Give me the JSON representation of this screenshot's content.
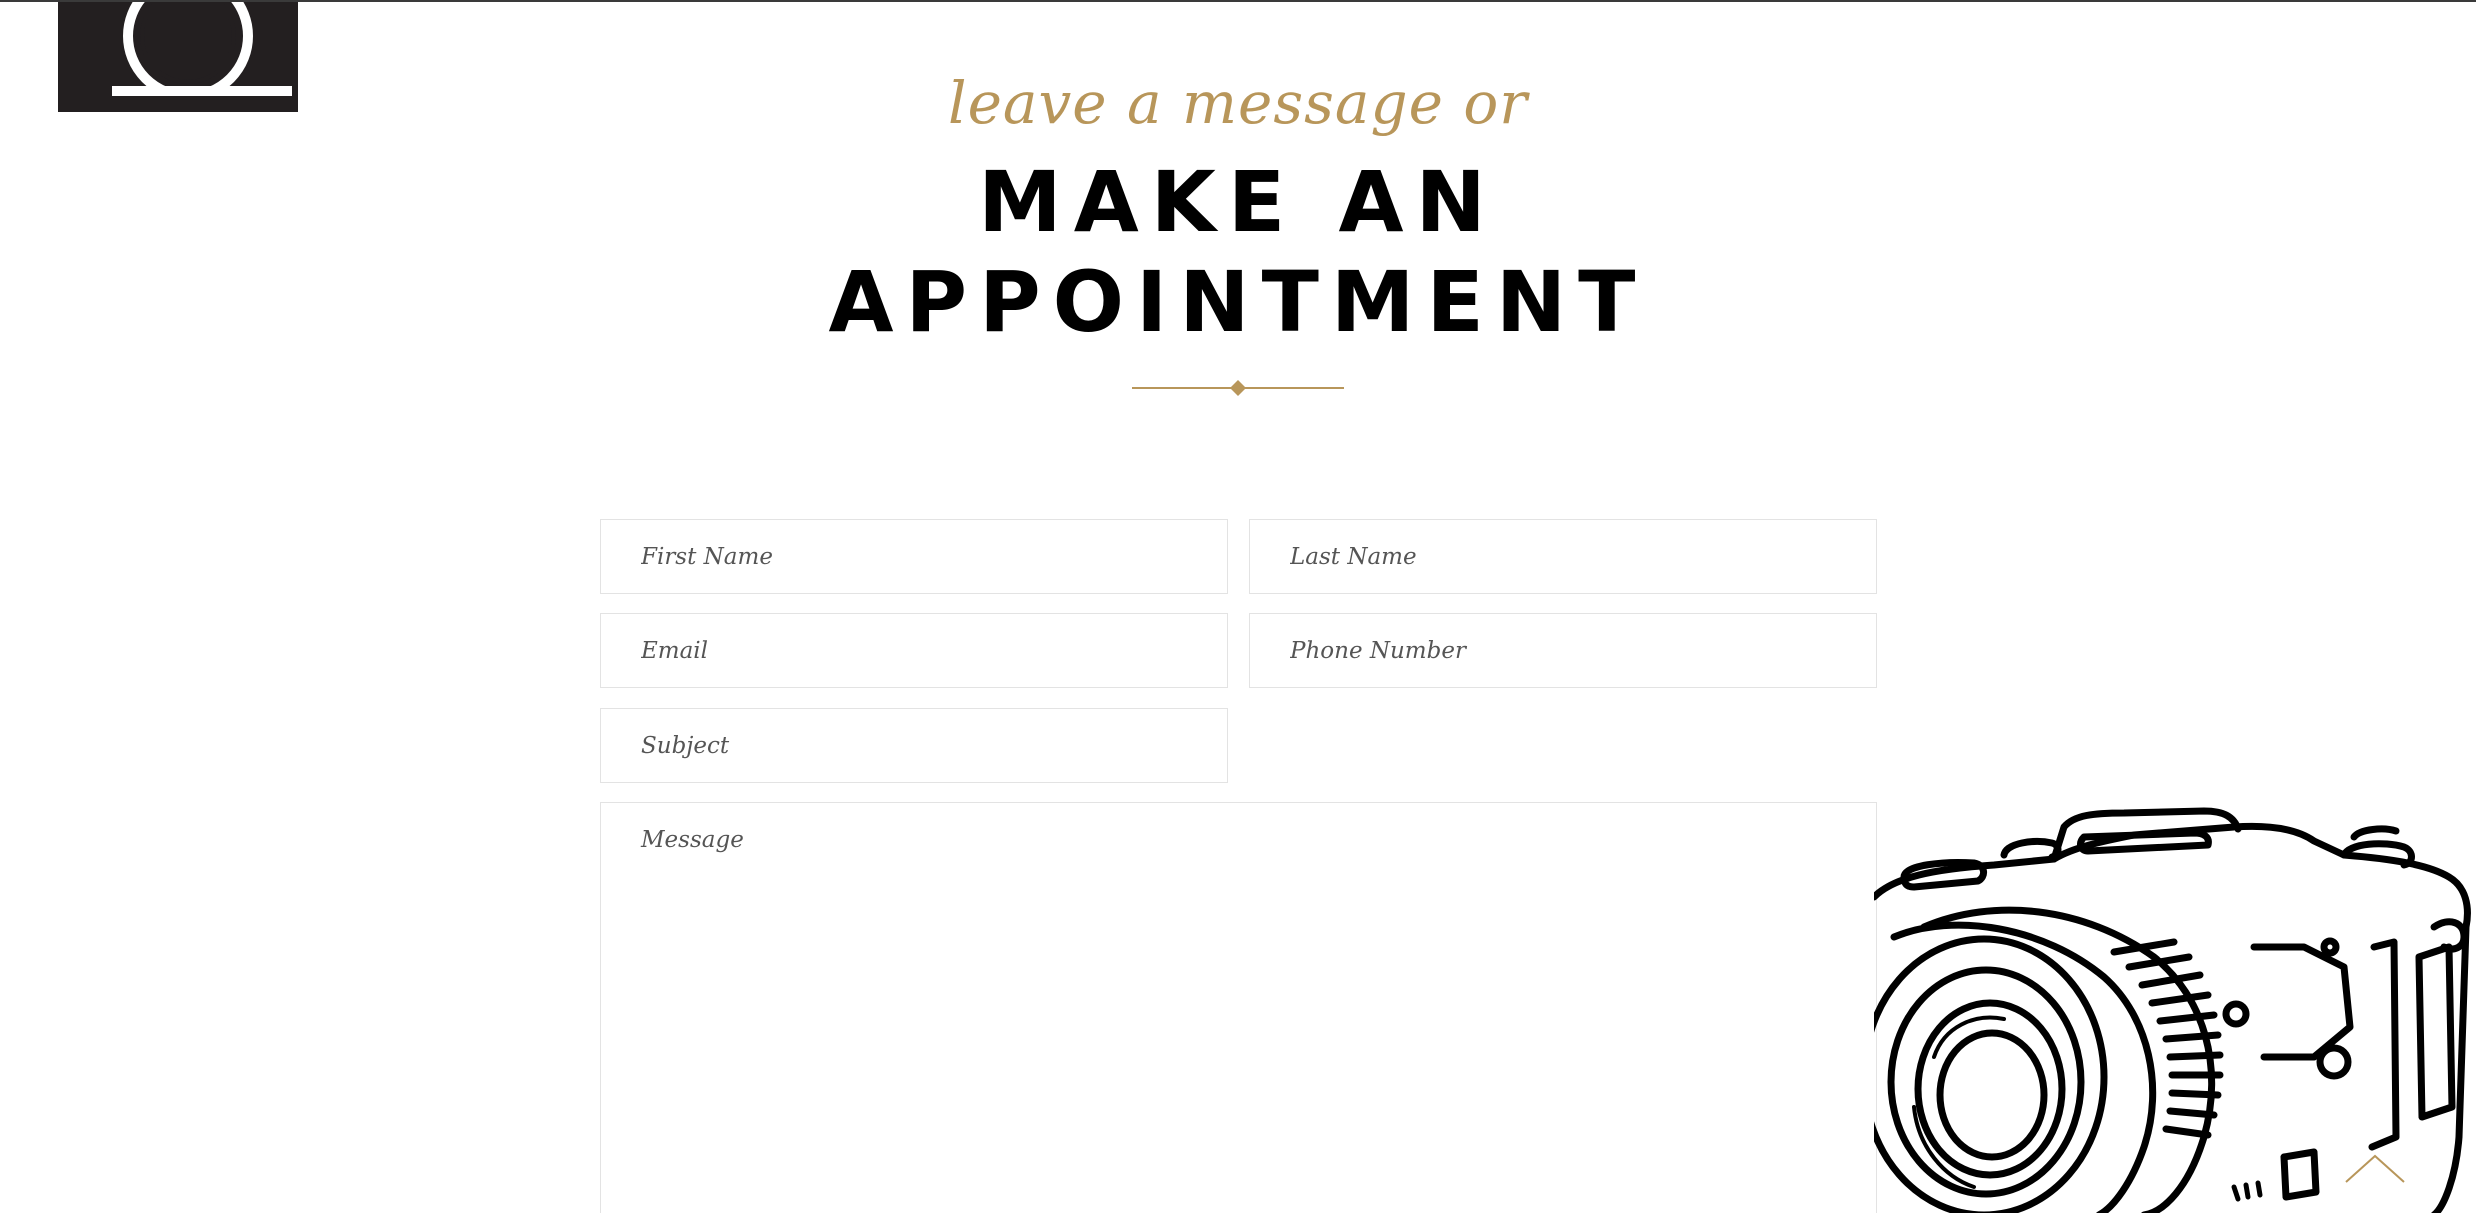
{
  "header": {
    "logo_icon": "camera-logo-icon"
  },
  "section": {
    "eyebrow": "leave a message or",
    "heading_line1": "MAKE AN",
    "heading_line2": "APPOINTMENT",
    "accent_color": "#b8965a",
    "divider_icon": "diamond-divider-icon"
  },
  "form": {
    "first_name_placeholder": "First Name",
    "last_name_placeholder": "Last Name",
    "email_placeholder": "Email",
    "phone_placeholder": "Phone Number",
    "subject_placeholder": "Subject",
    "message_placeholder": "Message",
    "first_name_value": "",
    "last_name_value": "",
    "email_value": "",
    "phone_value": "",
    "subject_value": "",
    "message_value": ""
  },
  "decor": {
    "camera_illustration": "camera-sketch-illustration",
    "back_to_top_icon": "chevron-up-icon"
  }
}
